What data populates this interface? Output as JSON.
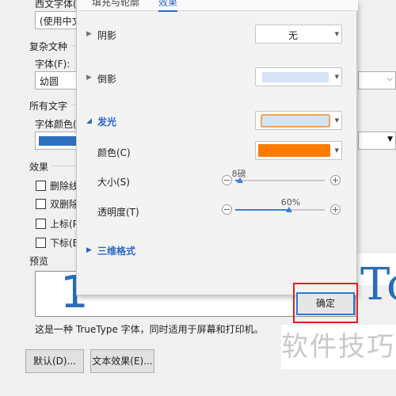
{
  "background_dialog": {
    "western_font_label": "西文字体(",
    "western_font_value": "(使用中文",
    "complex_section": "复杂文种",
    "font_label": "字体(F):",
    "font_value": "幼圆",
    "all_text_section": "所有文字",
    "font_color_label": "字体颜色(",
    "font_color": "#2f6fbf",
    "effects_section": "效果",
    "effects": [
      "删除线",
      "双删除",
      "上标(P",
      "下标(B"
    ],
    "preview_section": "预览",
    "preview_glyph_left": "1",
    "preview_glyph_right": "To",
    "truetype_note": "这是一种 TrueType 字体，同时适用于屏幕和打印机。",
    "default_button": "默认(D)...",
    "text_effects_button": "文本效果(E)..."
  },
  "panel": {
    "tabs": [
      "填充与轮廓",
      "效果"
    ],
    "active_tab_index": 1,
    "shadow": {
      "label": "阴影",
      "value": "无"
    },
    "reflection": {
      "label": "倒影",
      "swatch_color": "#d6e2f6"
    },
    "glow": {
      "label": "发光",
      "swatch_color": "#d6e2f6",
      "swatch_border": "#f5a35c",
      "color_label": "颜色(C)",
      "color_value": "#ff7a00",
      "size_label": "大小(S)",
      "size_value": "8磅",
      "size_fraction": 0.05,
      "transparency_label": "透明度(T)",
      "transparency_value": "60%",
      "transparency_fraction": 0.6
    },
    "three_d": {
      "label": "三维格式"
    }
  },
  "ok_button": "确定",
  "watermark": "软件技巧",
  "colors": {
    "accent": "#2b66c4",
    "highlight_box": "#e01f1f"
  },
  "icons": {
    "collapsed": "triangle-right-icon",
    "expanded": "triangle-down-icon",
    "dropdown": "chevron-down-icon"
  }
}
